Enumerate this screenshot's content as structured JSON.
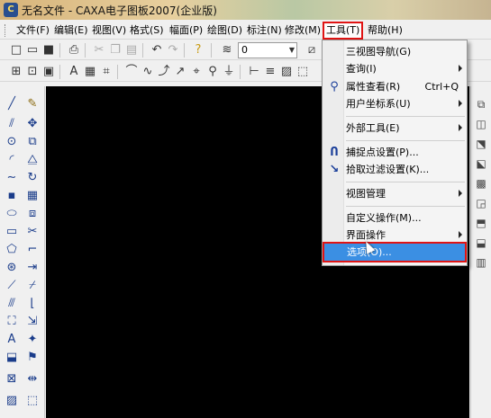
{
  "window": {
    "title": "无名文件 - CAXA电子图板2007(企业版)",
    "app_icon": "caxa-app-icon"
  },
  "menubar": {
    "items": [
      {
        "label": "文件(F)",
        "key": "file"
      },
      {
        "label": "编辑(E)",
        "key": "edit"
      },
      {
        "label": "视图(V)",
        "key": "view"
      },
      {
        "label": "格式(S)",
        "key": "format"
      },
      {
        "label": "幅面(P)",
        "key": "sheet"
      },
      {
        "label": "绘图(D)",
        "key": "draw"
      },
      {
        "label": "标注(N)",
        "key": "dimension"
      },
      {
        "label": "修改(M)",
        "key": "modify"
      },
      {
        "label": "工具(T)",
        "key": "tools",
        "active": true
      },
      {
        "label": "帮助(H)",
        "key": "help"
      }
    ]
  },
  "toolbar": {
    "layer_value": "0"
  },
  "tools_menu": {
    "items": [
      {
        "label": "三视图导航(G)",
        "shortcut": "",
        "submenu": false,
        "icon": ""
      },
      {
        "label": "查询(I)",
        "shortcut": "",
        "submenu": true,
        "icon": ""
      },
      {
        "label": "属性查看(R)",
        "shortcut": "Ctrl+Q",
        "submenu": false,
        "icon": "property-inspect-icon"
      },
      {
        "label": "用户坐标系(U)",
        "shortcut": "",
        "submenu": true,
        "icon": ""
      },
      {
        "label": "外部工具(E)",
        "shortcut": "",
        "submenu": true,
        "icon": ""
      },
      {
        "label": "捕捉点设置(P)...",
        "shortcut": "",
        "submenu": false,
        "icon": "snap-settings-icon"
      },
      {
        "label": "拾取过滤设置(K)...",
        "shortcut": "",
        "submenu": false,
        "icon": "pick-filter-icon"
      },
      {
        "label": "视图管理",
        "shortcut": "",
        "submenu": true,
        "icon": ""
      },
      {
        "label": "自定义操作(M)...",
        "shortcut": "",
        "submenu": false,
        "icon": ""
      },
      {
        "label": "界面操作",
        "shortcut": "",
        "submenu": true,
        "icon": ""
      },
      {
        "label": "选项(O)...",
        "shortcut": "",
        "submenu": false,
        "icon": "",
        "highlighted": true
      }
    ]
  },
  "colors": {
    "highlight": "#3b8fe3",
    "annotation_box": "#e01414",
    "canvas": "#000000"
  }
}
